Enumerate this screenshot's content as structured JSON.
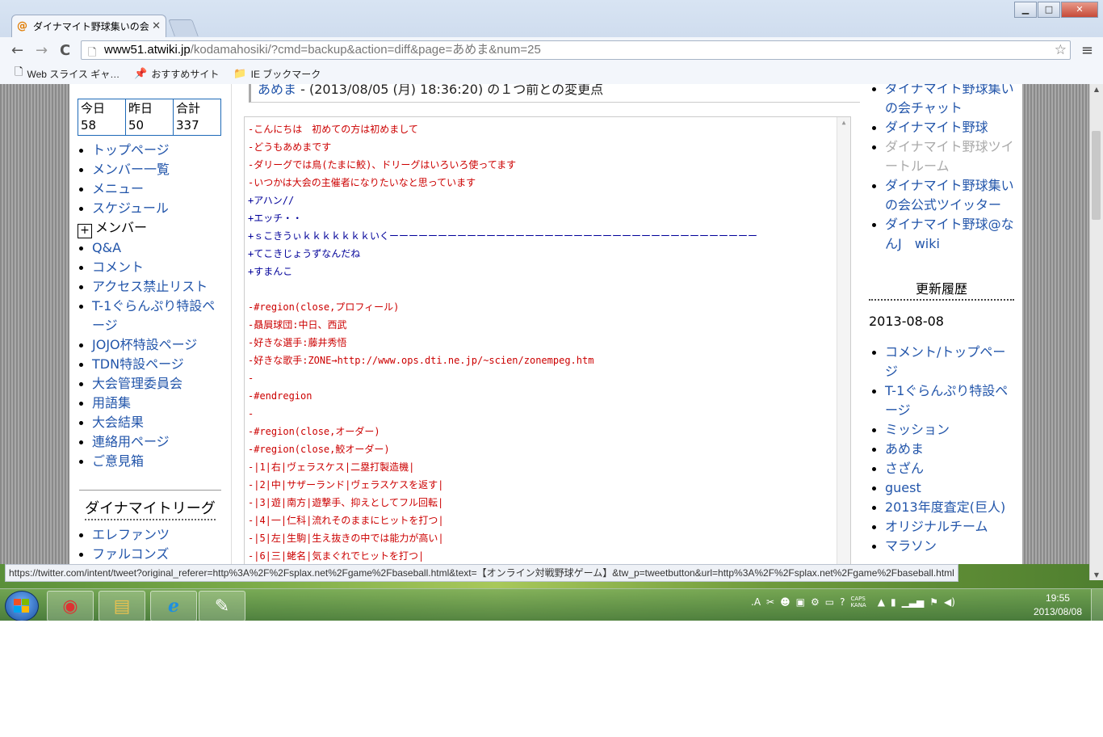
{
  "window": {
    "tab_title": "ダイナマイト野球集いの会",
    "minimize": "▁",
    "maximize": "□",
    "close": "✕"
  },
  "toolbar": {
    "back": "←",
    "forward": "→",
    "reload": "C",
    "url_host": "www51.atwiki.jp",
    "url_rest": "/kodamahosiki/?cmd=backup&action=diff&page=あめま&num=25",
    "star": "☆",
    "menu": "≡"
  },
  "bookmarks": [
    {
      "icon": "🗋",
      "label": "Web スライス ギャ…"
    },
    {
      "icon": "📌",
      "label": "おすすめサイト"
    },
    {
      "icon": "📁",
      "label": "IE ブックマーク"
    }
  ],
  "counter": {
    "today": "今日 58",
    "yesterday": "昨日 50",
    "total": "合計　337"
  },
  "left_nav": [
    "トップページ",
    "メンバー一覧",
    "メニュー",
    "スケジュール"
  ],
  "left_nav_member": "メンバー",
  "left_nav2": [
    "Q&A",
    "コメント",
    "アクセス禁止リスト",
    "T-1ぐらんぷり特設ページ",
    "JOJO杯特設ページ",
    "TDN特設ページ",
    "大会管理委員会",
    "用語集",
    "大会結果",
    "連絡用ページ",
    "ご意見箱"
  ],
  "league_title": "ダイナマイトリーグ",
  "league_list": [
    "エレファンツ",
    "ファルコンズ"
  ],
  "diff": {
    "page_name": "あめま",
    "heading": " - (2013/08/05 (月) 18:36:20) の１つ前との変更点",
    "lines": [
      {
        "t": "del",
        "text": "-こんにちは　初めての方は初めまして"
      },
      {
        "t": "del",
        "text": "-どうもあめまです"
      },
      {
        "t": "del",
        "text": "-ダリーグでは鳥(たまに鮫)、ドリーグはいろいろ使ってます"
      },
      {
        "t": "del",
        "text": "-いつかは大会の主催者になりたいなと思っています"
      },
      {
        "t": "add",
        "text": "+アハン//"
      },
      {
        "t": "add",
        "text": "+エッチ・・"
      },
      {
        "t": "add",
        "text": "+ｓこきうぃｋｋｋｋｋｋｋいくーーーーーーーーーーーーーーーーーーーーーーーーーーーーーーーーーーーーーー"
      },
      {
        "t": "add",
        "text": "+てこきじょうずなんだね"
      },
      {
        "t": "add",
        "text": "+すまんこ"
      },
      {
        "t": "add",
        "text": ""
      },
      {
        "t": "del",
        "text": "-#region(close,プロフィール)"
      },
      {
        "t": "del",
        "text": "-贔屓球団:中日、西武"
      },
      {
        "t": "del",
        "text": "-好きな選手:藤井秀悟"
      },
      {
        "t": "del",
        "text": "-好きな歌手:ZONE→http://www.ops.dti.ne.jp/~scien/zonempeg.htm"
      },
      {
        "t": "del",
        "text": "-"
      },
      {
        "t": "del",
        "text": "-#endregion"
      },
      {
        "t": "del",
        "text": "-"
      },
      {
        "t": "del",
        "text": "-#region(close,オーダー)"
      },
      {
        "t": "del",
        "text": "-#region(close,鮫オーダー)"
      },
      {
        "t": "del",
        "text": "-|1|右|ヴェラスケス|二塁打製造機|"
      },
      {
        "t": "del",
        "text": "-|2|中|サザーランド|ヴェラスケスを返す|"
      },
      {
        "t": "del",
        "text": "-|3|遊|南方|遊撃手、抑えとしてフル回転|"
      },
      {
        "t": "del",
        "text": "-|4|一|仁科|流れそのままにヒットを打つ|"
      },
      {
        "t": "del",
        "text": "-|5|左|生駒|生え抜きの中では能力が高い|"
      },
      {
        "t": "del",
        "text": "-|6|三|蛯名|気まぐれでヒットを打つ|"
      }
    ]
  },
  "right_links": [
    {
      "label": "ダイナマイト野球集いの会チャット",
      "gray": false
    },
    {
      "label": "ダイナマイト野球",
      "gray": false
    },
    {
      "label": "ダイナマイト野球ツイートルーム",
      "gray": true
    },
    {
      "label": "ダイナマイト野球集いの会公式ツイッター",
      "gray": false
    },
    {
      "label": "ダイナマイト野球@なんJ　wiki",
      "gray": false
    }
  ],
  "updates": {
    "title": "更新履歴",
    "date": "2013-08-08",
    "items": [
      "コメント/トップページ",
      "T-1ぐらんぷり特設ページ",
      "ミッション",
      "あめま",
      "さざん",
      "guest",
      "2013年度査定(巨人)",
      "オリジナルチーム",
      "マラソン"
    ]
  },
  "status_url": "https://twitter.com/intent/tweet?original_referer=http%3A%2F%2Fsplax.net%2Fgame%2Fbaseball.html&text=【オンライン対戦野球ゲーム】&tw_p=tweetbutton&url=http%3A%2F%2Fsplax.net%2Fgame%2Fbaseball.html",
  "taskbar": {
    "apps": [
      {
        "name": "chrome",
        "icon": "◉"
      },
      {
        "name": "explorer",
        "icon": "▤"
      },
      {
        "name": "ie",
        "icon": "ℯ"
      },
      {
        "name": "paint",
        "icon": "✎"
      }
    ],
    "tray_ime": ".A",
    "caps": "CAPS",
    "kana": "KANA",
    "time": "19:55",
    "date": "2013/08/08"
  },
  "colors": {
    "link": "#2255aa",
    "deleted": "#cc0000",
    "added": "#000099"
  }
}
